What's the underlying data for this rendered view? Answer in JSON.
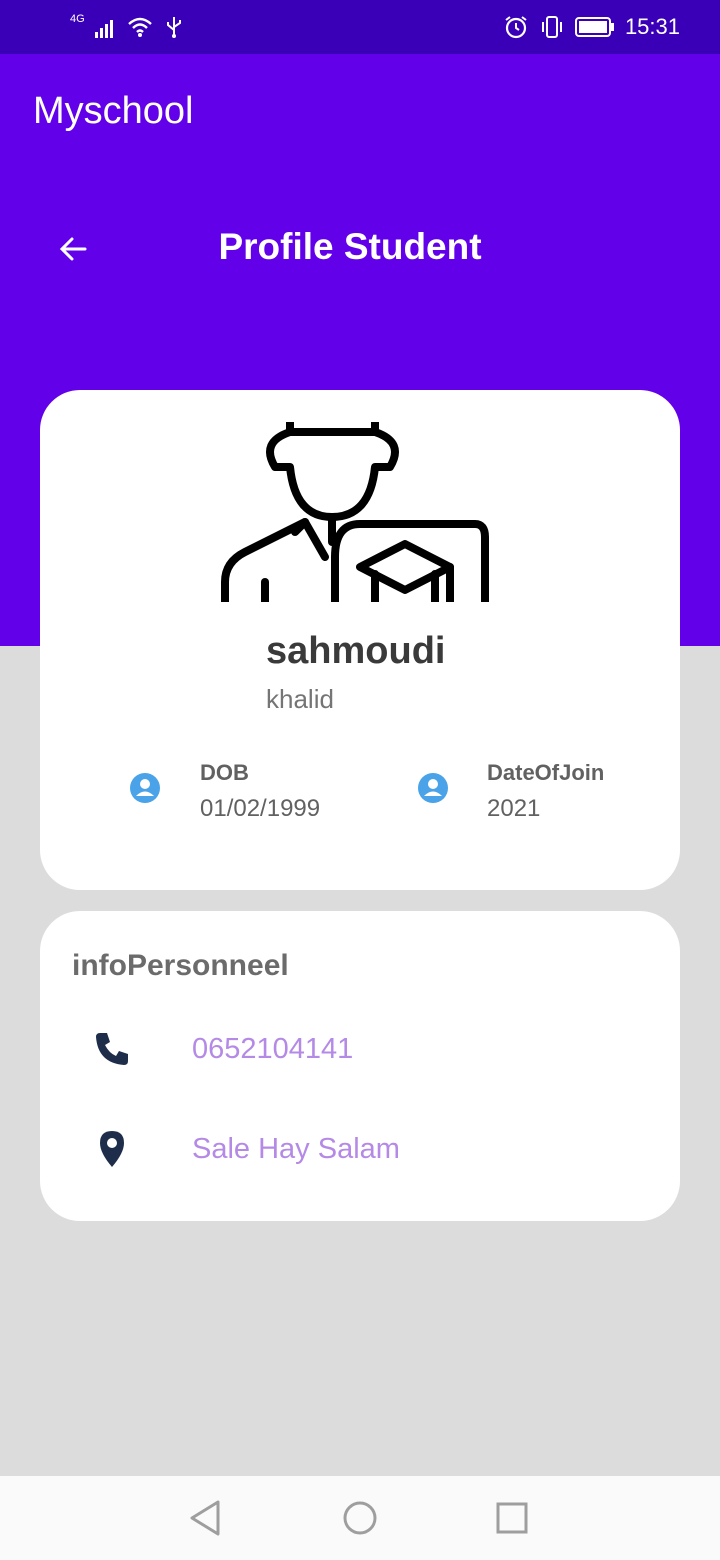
{
  "status_bar": {
    "time": "15:31",
    "network": "4G",
    "icons": [
      "signal-icon",
      "wifi-icon",
      "usb-icon",
      "alarm-icon",
      "vibrate-icon",
      "battery-icon"
    ]
  },
  "app_bar": {
    "title": "Myschool"
  },
  "header": {
    "title": "Profile Student",
    "back_icon": "arrow-left-icon"
  },
  "profile": {
    "avatar_icon": "student-graduate-icon",
    "last_name": "sahmoudi",
    "first_name": "khalid",
    "dob": {
      "label": "DOB",
      "value": "01/02/1999"
    },
    "date_of_join": {
      "label": "DateOfJoin",
      "value": "2021"
    }
  },
  "info": {
    "title": "infoPersonneel",
    "phone": "0652104141",
    "address": "Sale Hay Salam"
  },
  "colors": {
    "status_bar": "#3a00b8",
    "primary": "#6200ea",
    "background": "#dcdcdc",
    "link": "#b48ae6",
    "badge": "#4aa3e8"
  },
  "nav_bar": {
    "icons": [
      "back-triangle-icon",
      "home-circle-icon",
      "recents-square-icon"
    ]
  }
}
